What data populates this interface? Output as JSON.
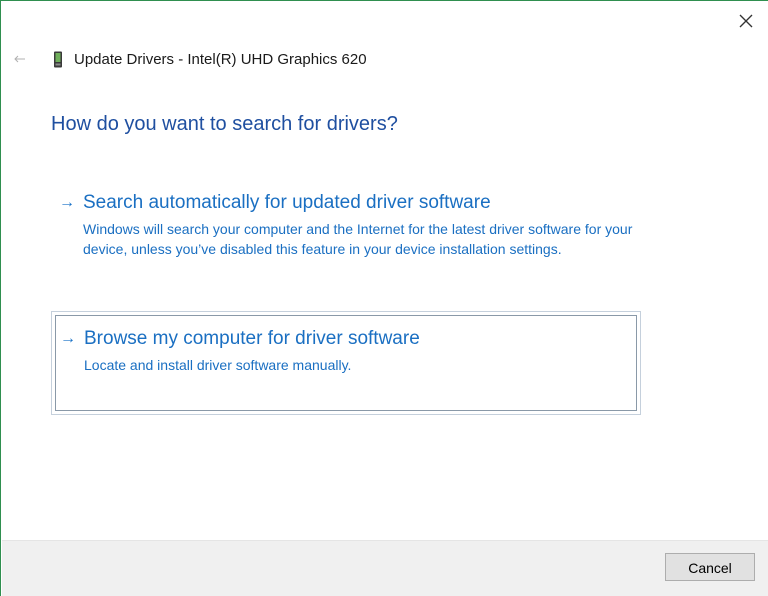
{
  "window": {
    "title": "Update Drivers - Intel(R) UHD Graphics 620",
    "close_icon": "close-icon",
    "back_icon": "back-arrow-icon",
    "device_icon": "graphics-device-icon"
  },
  "main": {
    "question": "How do you want to search for drivers?",
    "options": [
      {
        "arrow": "→",
        "title": "Search automatically for updated driver software",
        "description": "Windows will search your computer and the Internet for the latest driver software for your device, unless you’ve disabled this feature in your device installation settings."
      },
      {
        "arrow": "→",
        "title": "Browse my computer for driver software",
        "description": "Locate and install driver software manually."
      }
    ]
  },
  "footer": {
    "cancel_label": "Cancel"
  },
  "colors": {
    "heading": "#1f4fa0",
    "link": "#1a6fc2",
    "footer_bg": "#f0f0f0"
  }
}
